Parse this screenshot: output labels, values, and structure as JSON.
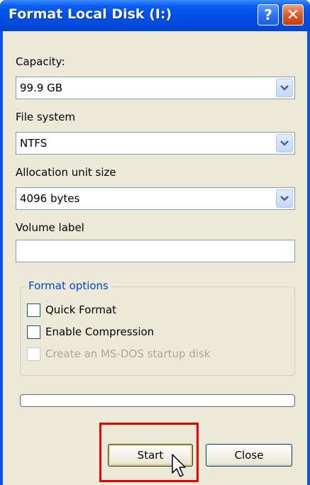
{
  "window": {
    "title": "Format Local Disk (I:)",
    "help_glyph": "?",
    "close_glyph": "✕"
  },
  "capacity": {
    "label": "Capacity:",
    "value": "99.9 GB"
  },
  "file_system": {
    "label": "File system",
    "value": "NTFS"
  },
  "allocation": {
    "label": "Allocation unit size",
    "value": "4096 bytes"
  },
  "volume_label": {
    "label": "Volume label",
    "value": ""
  },
  "format_options": {
    "title": "Format options",
    "quick_format": {
      "label": "Quick Format",
      "checked": false
    },
    "enable_compression": {
      "label": "Enable Compression",
      "checked": false
    },
    "msdos_startup": {
      "label": "Create an MS-DOS startup disk",
      "checked": false,
      "disabled": true
    }
  },
  "progress": 0,
  "buttons": {
    "start": "Start",
    "close": "Close"
  },
  "colors": {
    "title_bar": "#0a5cf0",
    "highlight_box": "#e00000",
    "group_title": "#0046d5"
  }
}
